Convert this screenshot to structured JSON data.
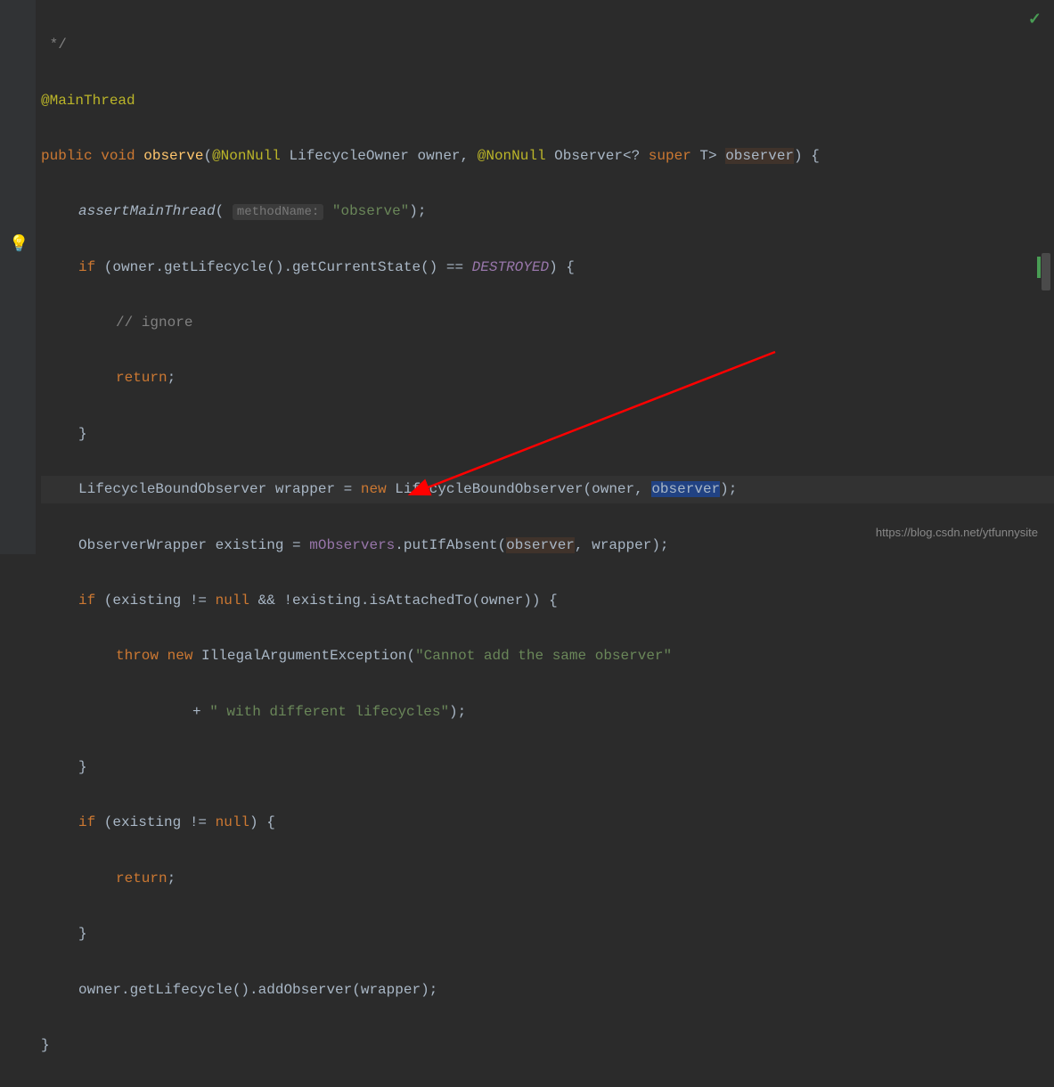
{
  "code": {
    "comment_end": " */",
    "annotation": "@MainThread",
    "modifier_public": "public",
    "modifier_void": "void",
    "method_name": "observe",
    "nonnull": "@NonNull",
    "param1_type": "LifecycleOwner",
    "param1_name": "owner",
    "param2_type": "Observer",
    "param2_generic_prefix": "<? ",
    "param2_super": "super",
    "param2_generic_suffix": " T> ",
    "param2_name": "observer",
    "assert_call": "assertMainThread",
    "param_hint": "methodName:",
    "assert_arg": "\"observe\"",
    "if_kw": "if",
    "owner_get_lifecycle": "owner.getLifecycle().getCurrentState() == ",
    "destroyed": "DESTROYED",
    "ignore_comment": "// ignore",
    "return_kw": "return",
    "wrapper_type": "LifecycleBoundObserver",
    "wrapper_var": " wrapper = ",
    "new_kw": "new",
    "wrapper_ctor": " LifecycleBoundObserver(owner, ",
    "observer_ref": "observer",
    "existing_type": "ObserverWrapper",
    "existing_var": " existing = ",
    "mobservers": "mObservers",
    "put_if_absent": ".putIfAbsent(",
    "wrapper_arg": ", wrapper);",
    "existing_null_check": " (existing != ",
    "null_kw": "null",
    "and_check": " && !existing.isAttachedTo(owner)) {",
    "throw_kw": "throw",
    "illegal_arg": " IllegalArgumentException(",
    "error_msg1": "\"Cannot add the same observer\"",
    "error_msg2": "\" with different lifecycles\"",
    "plus": "+ ",
    "existing_null2": " (existing != ",
    "add_observer": "owner.getLifecycle().addObserver(wrapper);"
  },
  "watermark": "https://blog.csdn.net/ytfunnysite"
}
